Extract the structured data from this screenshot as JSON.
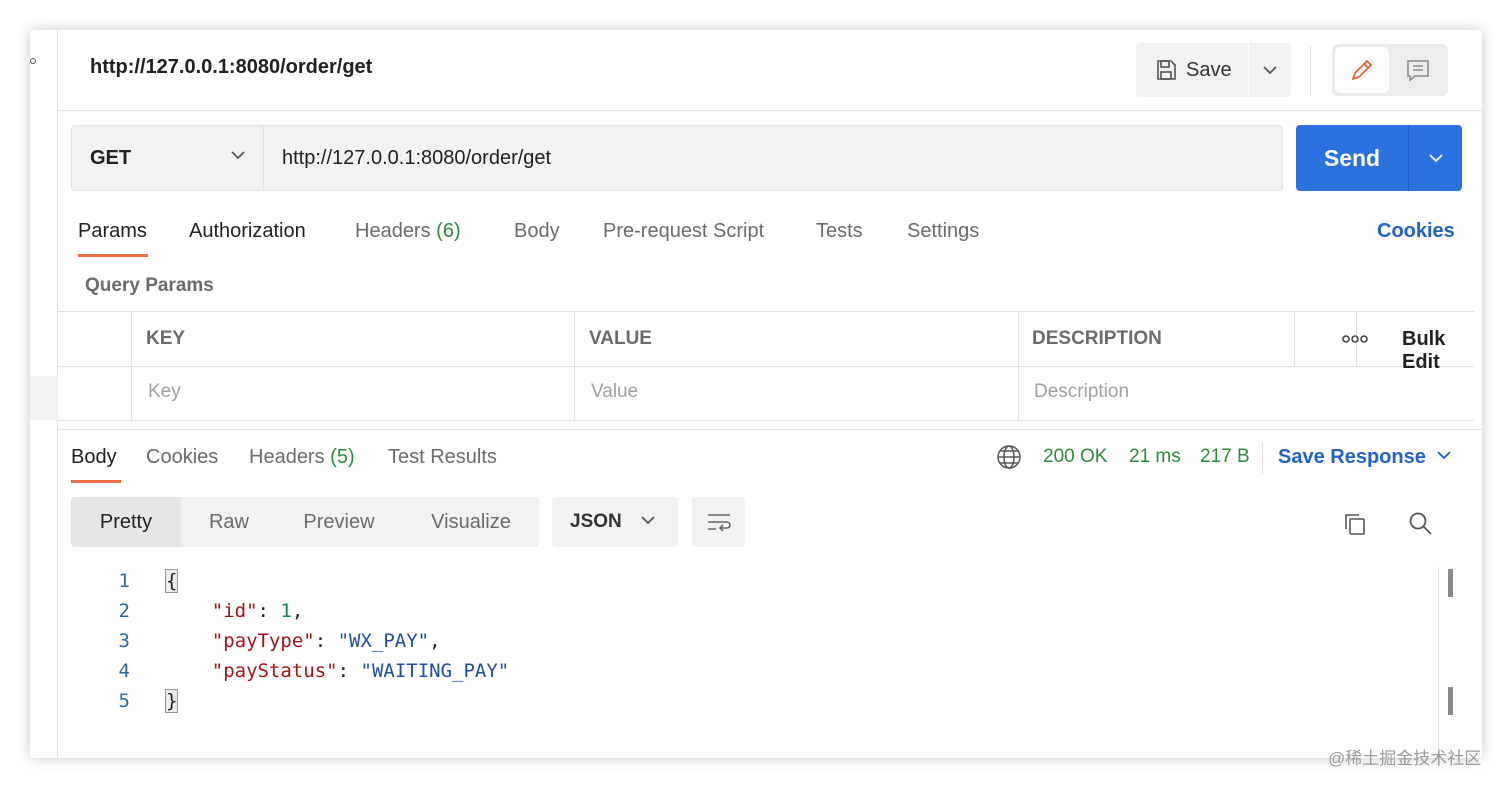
{
  "header": {
    "title": "http://127.0.0.1:8080/order/get",
    "save_label": "Save"
  },
  "request": {
    "method": "GET",
    "url": "http://127.0.0.1:8080/order/get",
    "send_label": "Send"
  },
  "request_tabs": [
    {
      "label": "Params",
      "count": ""
    },
    {
      "label": "Authorization",
      "count": ""
    },
    {
      "label": "Headers",
      "count": "(6)"
    },
    {
      "label": "Body",
      "count": ""
    },
    {
      "label": "Pre-request Script",
      "count": ""
    },
    {
      "label": "Tests",
      "count": ""
    },
    {
      "label": "Settings",
      "count": ""
    }
  ],
  "cookies_link": "Cookies",
  "query_params": {
    "title": "Query Params",
    "headers": [
      "KEY",
      "VALUE",
      "DESCRIPTION"
    ],
    "bulk_edit": "Bulk Edit",
    "placeholders": {
      "key": "Key",
      "value": "Value",
      "description": "Description"
    }
  },
  "response_tabs": [
    {
      "label": "Body",
      "count": ""
    },
    {
      "label": "Cookies",
      "count": ""
    },
    {
      "label": "Headers",
      "count": "(5)"
    },
    {
      "label": "Test Results",
      "count": ""
    }
  ],
  "response_status": {
    "status": "200 OK",
    "time": "21 ms",
    "size": "217 B",
    "save_response": "Save Response"
  },
  "view_modes": [
    "Pretty",
    "Raw",
    "Preview",
    "Visualize"
  ],
  "format": "JSON",
  "code_lines": [
    {
      "n": "1",
      "text": "{"
    },
    {
      "n": "2",
      "key": "\"id\"",
      "sep": ": ",
      "num": "1",
      "end": ","
    },
    {
      "n": "3",
      "key": "\"payType\"",
      "sep": ": ",
      "str": "\"WX_PAY\"",
      "end": ","
    },
    {
      "n": "4",
      "key": "\"payStatus\"",
      "sep": ": ",
      "str": "\"WAITING_PAY\"",
      "end": ""
    },
    {
      "n": "5",
      "text": "}"
    }
  ],
  "watermark": "@稀土掘金技术社区",
  "colors": {
    "accent": "#2b72e0",
    "active_tab_underline": "#ef6c45",
    "status_ok": "#2b8a3e",
    "link": "#1f63c8"
  }
}
